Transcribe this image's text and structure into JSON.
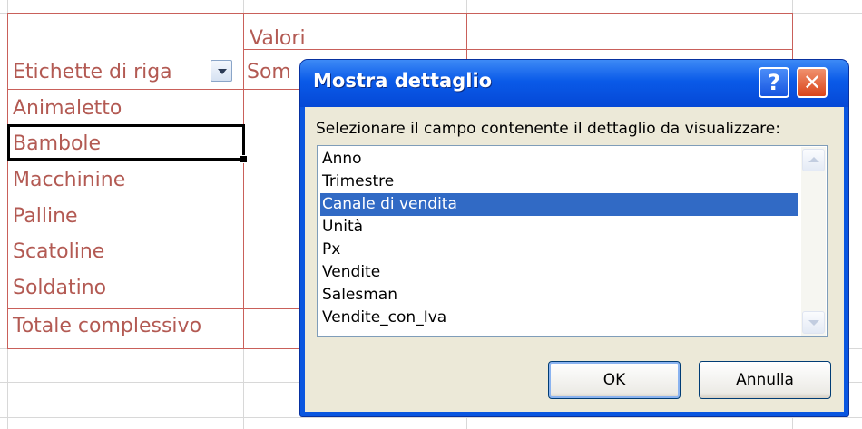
{
  "sheet": {
    "header_values": "Valori",
    "header_row_labels": "Etichette di riga",
    "header_sum_partial": "Som",
    "rows": [
      "Animaletto",
      "Bambole",
      "Macchinine",
      "Palline",
      "Scatoline",
      "Soldatino"
    ],
    "grand_total": "Totale complessivo",
    "accent_color": "#b35a53"
  },
  "dialog": {
    "title": "Mostra dettaglio",
    "help_glyph": "?",
    "close_glyph": "✕",
    "prompt": "Selezionare il campo contenente il dettaglio da visualizzare:",
    "fields": [
      "Anno",
      "Trimestre",
      "Canale di vendita",
      "Unità",
      "Px",
      "Vendite",
      "Salesman",
      "Vendite_con_Iva"
    ],
    "selected_field": "Canale di vendita",
    "ok_label": "OK",
    "cancel_label": "Annulla",
    "title_color": "#0a56e0",
    "selection_color": "#316ac5"
  }
}
